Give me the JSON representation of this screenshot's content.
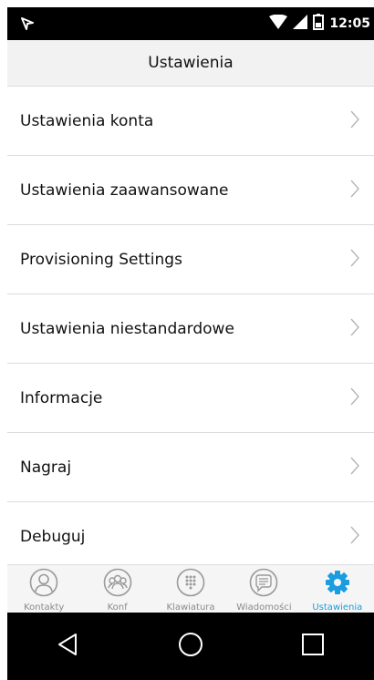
{
  "status_bar": {
    "time": "12:05"
  },
  "header": {
    "title": "Ustawienia"
  },
  "settings_items": [
    {
      "label": "Ustawienia konta"
    },
    {
      "label": "Ustawienia zaawansowane"
    },
    {
      "label": "Provisioning Settings"
    },
    {
      "label": "Ustawienia niestandardowe"
    },
    {
      "label": "Informacje"
    },
    {
      "label": "Nagraj"
    },
    {
      "label": "Debuguj"
    }
  ],
  "tabs": [
    {
      "label": "Kontakty",
      "icon": "contact-icon"
    },
    {
      "label": "Konf",
      "icon": "conference-icon"
    },
    {
      "label": "Klawiatura",
      "icon": "keypad-icon"
    },
    {
      "label": "Wiadomości",
      "icon": "messages-icon"
    },
    {
      "label": "Ustawienia",
      "icon": "gear-icon",
      "active": true
    }
  ],
  "colors": {
    "accent": "#1a9de0",
    "inactive_icon": "#9a9a9a"
  }
}
